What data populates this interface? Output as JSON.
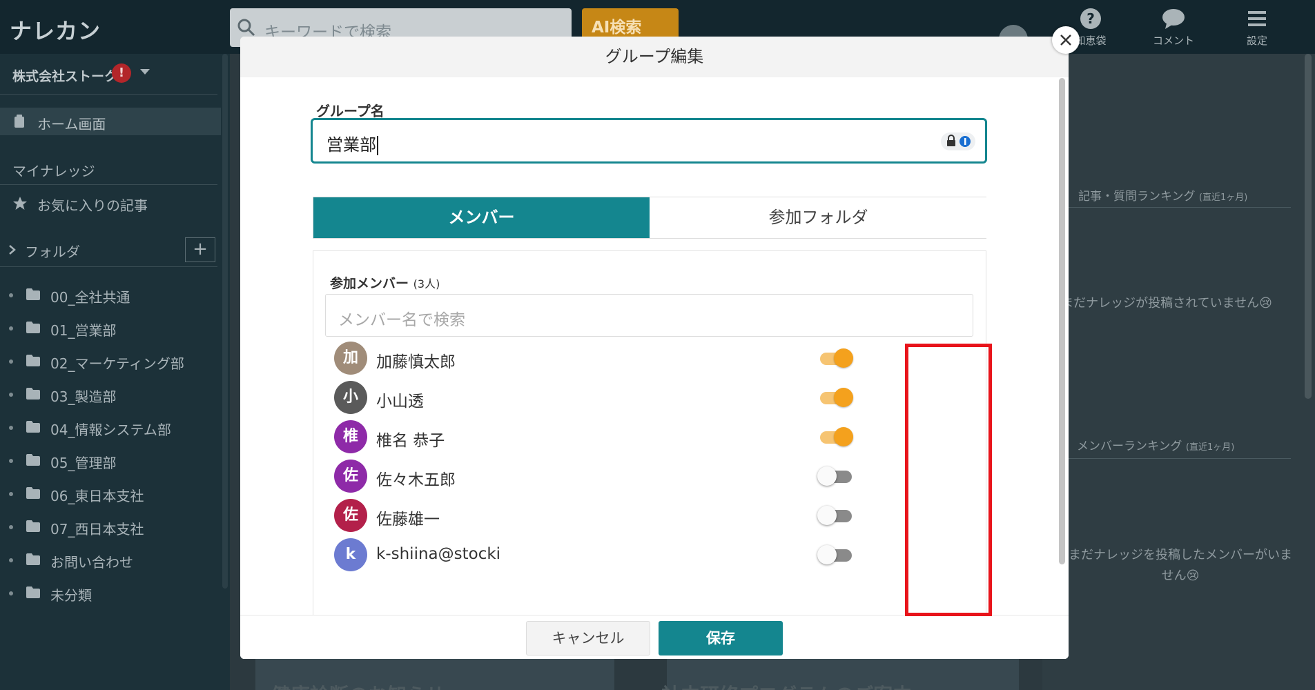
{
  "header": {
    "logo": "ナレカン",
    "search_placeholder": "キーワードで検索",
    "ai_search_label": "AI検索",
    "items": [
      {
        "label": "知恵袋",
        "icon": "question-icon"
      },
      {
        "label": "コメント",
        "icon": "comment-icon"
      },
      {
        "label": "設定",
        "icon": "menu-icon"
      }
    ]
  },
  "sidebar": {
    "company": "株式会社ストーク",
    "company_alert": "!",
    "home": "ホーム画面",
    "my_knowledge": "マイナレッジ",
    "favorites": "お気に入りの記事",
    "folders_label": "フォルダ",
    "add_label": "+",
    "folders": [
      "00_全社共通",
      "01_営業部",
      "02_マーケティング部",
      "03_製造部",
      "04_情報システム部",
      "05_管理部",
      "06_東日本支社",
      "07_西日本支社",
      "お問い合わせ",
      "未分類"
    ]
  },
  "right_panel": {
    "ranking_title": "記事・質問ランキング",
    "ranking_period": "(直近1ヶ月)",
    "ranking_empty": "まだナレッジが投稿されていません😢",
    "member_ranking_title": "メンバーランキング",
    "member_ranking_period": "(直近1ヶ月)",
    "member_ranking_empty": "まだナレッジを投稿したメンバーがいません😢"
  },
  "background": {
    "card_title_left": "健康診断のお知らせ",
    "card_title_right": "社内研修プログラムのご案内"
  },
  "modal": {
    "title": "グループ編集",
    "group_name_label": "グループ名",
    "group_name_value": "営業部",
    "tabs": {
      "members": "メンバー",
      "folders": "参加フォルダ"
    },
    "members_heading": "参加メンバー",
    "members_count": "(3人)",
    "member_search_placeholder": "メンバー名で検索",
    "members": [
      {
        "initial": "加",
        "name": "加藤慎太郎",
        "color": "#a08c79",
        "enabled": true
      },
      {
        "initial": "小",
        "name": "小山透",
        "color": "#5a5a5a",
        "enabled": true
      },
      {
        "initial": "椎",
        "name": "椎名 恭子",
        "color": "#8e2aa8",
        "enabled": true
      },
      {
        "initial": "佐",
        "name": "佐々木五郎",
        "color": "#8e2aa8",
        "enabled": false
      },
      {
        "initial": "佐",
        "name": "佐藤雄一",
        "color": "#b3204a",
        "enabled": false
      },
      {
        "initial": "k",
        "name": "k-shiina@stocki",
        "color": "#6c7bd1",
        "enabled": false
      }
    ],
    "cancel_label": "キャンセル",
    "save_label": "保存"
  },
  "colors": {
    "accent": "#14868f",
    "toggle_on": "#f4a11d",
    "highlight": "#e8141b"
  }
}
